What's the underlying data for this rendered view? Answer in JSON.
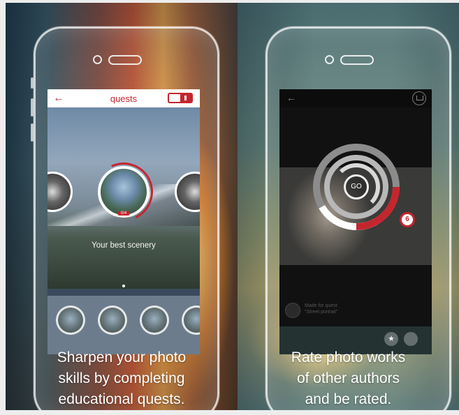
{
  "left_panel": {
    "screen": {
      "title": "quests",
      "back_icon": "←",
      "quest_label": "Your best scenery",
      "quest_badge": "0/4"
    },
    "caption": [
      "Sharpen your photo",
      "skills by completing",
      "educational quests."
    ]
  },
  "right_panel": {
    "screen": {
      "back_icon": "←",
      "go_label": "GO",
      "rating_value": "6",
      "author_line_1": "Made for quest",
      "author_line_2": "\"Street portrait\"",
      "star_icon": "★"
    },
    "caption": [
      "Rate photo works",
      "of other authors",
      "and be rated."
    ]
  },
  "colors": {
    "accent": "#c4262e"
  }
}
